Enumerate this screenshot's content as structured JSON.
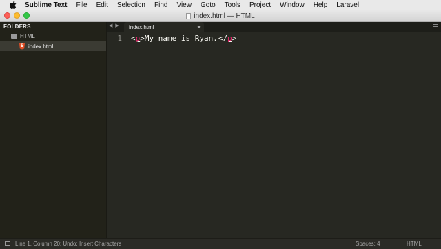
{
  "menubar": {
    "icon": "apple-icon",
    "app_name": "Sublime Text",
    "items": [
      "File",
      "Edit",
      "Selection",
      "Find",
      "View",
      "Goto",
      "Tools",
      "Project",
      "Window",
      "Help",
      "Laravel"
    ]
  },
  "window": {
    "title": "index.html — HTML"
  },
  "sidebar": {
    "header": "FOLDERS",
    "folder": "HTML",
    "file": "index.html"
  },
  "tabs": {
    "active": "index.html",
    "close_glyph": "●"
  },
  "editor": {
    "line_number": "1",
    "code": {
      "open_lt": "<",
      "open_tag": "p",
      "open_gt": ">",
      "text": "My name is Ryan.",
      "close_lt": "</",
      "close_tag": "p",
      "close_gt": ">"
    }
  },
  "statusbar": {
    "position": "Line 1, Column 20; Undo: Insert Characters",
    "indentation": "Spaces: 4",
    "syntax": "HTML"
  },
  "colors": {
    "editor_bg": "#272822",
    "tag": "#f92672",
    "text": "#f8f8f2",
    "sidebar_bg": "#222219"
  }
}
